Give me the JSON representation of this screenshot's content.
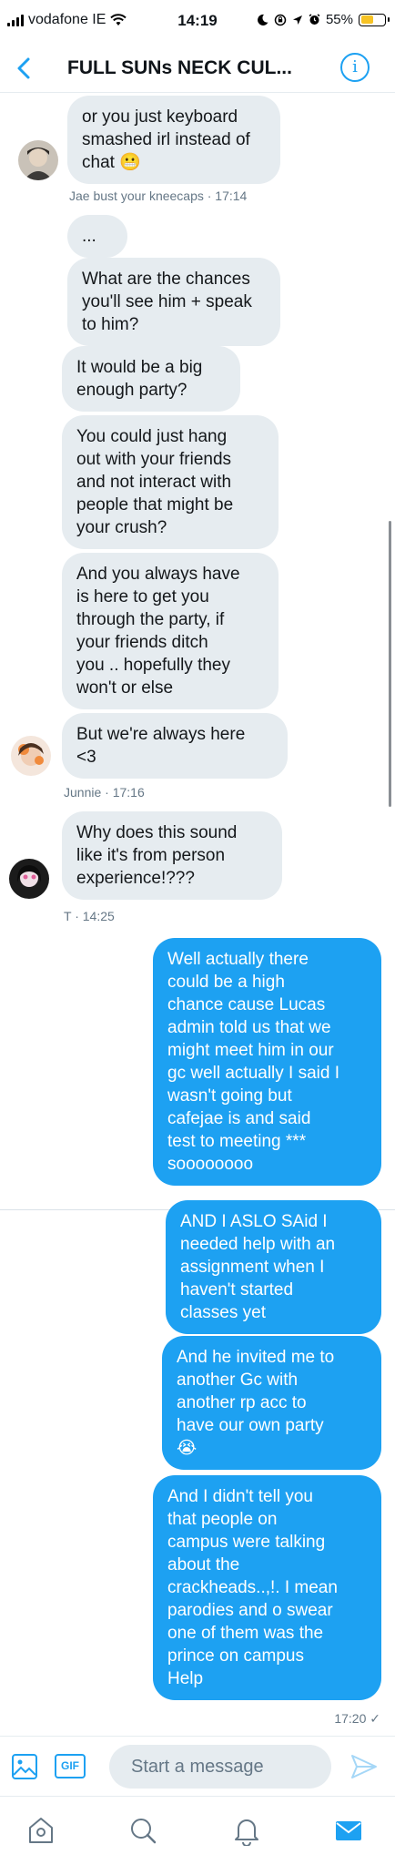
{
  "status_bar": {
    "carrier": "vodafone IE",
    "time": "14:19",
    "battery_percent": "55%",
    "battery_level": 0.55,
    "battery_color": "#f7c325",
    "icons": [
      "signal-icon",
      "wifi-icon",
      "moon-icon",
      "lock-rotation-icon",
      "location-icon",
      "alarm-icon",
      "battery-icon"
    ]
  },
  "header": {
    "title": "FULL SUNs NECK CUL...",
    "back_icon": "chevron-left-icon",
    "info_icon": "info-icon",
    "info_glyph": "i"
  },
  "accent_color": "#1da1f2",
  "messages": [
    {
      "direction": "received",
      "text": "or you just keyboard\nsmashed irl instead of\nchat 😬"
    },
    {
      "direction": "meta",
      "text": "Jae bust your kneecaps · 17:14"
    },
    {
      "direction": "received",
      "text": "..."
    },
    {
      "direction": "received",
      "text": "What are the chances\nyou'll see him + speak\nto him?"
    },
    {
      "direction": "received",
      "text": "It would be a big\nenough party?"
    },
    {
      "direction": "received",
      "text": "You could just hang\nout with your friends\nand not interact with\npeople that might be\nyour crush?"
    },
    {
      "direction": "received",
      "text": "And you always have\nis here to get you\nthrough the party, if\nyour friends ditch\nyou .. hopefully they\nwon't or else"
    },
    {
      "direction": "received",
      "text": "But we're always here\n<3"
    },
    {
      "direction": "meta",
      "text": "Junnie · 17:16"
    },
    {
      "direction": "received",
      "text": "Why does this sound\nlike it's from person\nexperience!???"
    },
    {
      "direction": "meta",
      "text": "T · 14:25"
    },
    {
      "direction": "sent",
      "text": "Well actually there\ncould be a high\nchance cause Lucas\nadmin told us that we\nmight meet him in our\ngc well actually I said I\nwasn't going but\ncafejae is and said\ntest to meeting ***\nsoooooooo"
    },
    {
      "direction": "sent",
      "text": "AND I ASLO SAid I\nneeded help with an\nassignment when I\nhaven't started\nclasses yet"
    },
    {
      "direction": "sent",
      "text": "And he invited me to\nanother Gc with\nanother rp acc to\nhave our own party\n😭"
    },
    {
      "direction": "sent",
      "text": "And I didn't tell you\nthat people on\ncampus were talking\nabout the\ncrackheads..,!. I mean\nparodies and o swear\none of them was the\nprince on campus\nHelp"
    },
    {
      "direction": "meta",
      "text": "17:20 ✓"
    }
  ],
  "composer": {
    "placeholder": "Start a message",
    "image_icon": "image-icon",
    "gif_label": "GIF",
    "send_icon": "send-icon"
  },
  "bottom_nav": [
    {
      "name": "home",
      "icon": "home-icon"
    },
    {
      "name": "search",
      "icon": "search-icon"
    },
    {
      "name": "notifications",
      "icon": "bell-icon"
    },
    {
      "name": "messages",
      "icon": "mail-icon",
      "active": true
    }
  ]
}
